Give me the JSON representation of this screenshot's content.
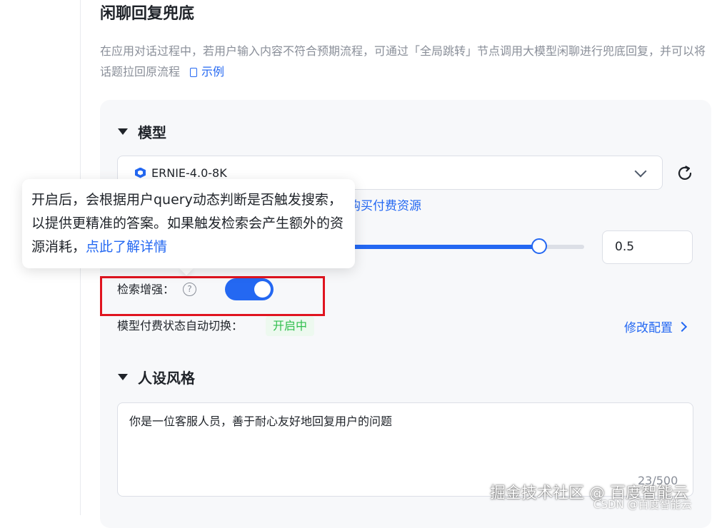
{
  "header": {
    "title": "闲聊回复兜底",
    "description": "在应用对话过程中，若用户输入内容不符合预期流程，可通过「全局跳转」节点调用大模型闲聊进行兜底回复，并可以将话题拉回原流程",
    "example_link": "示例"
  },
  "model_section": {
    "title": "模型",
    "selected_model": "ERNIE-4.0-8K",
    "buy_link_fragment": "购买付费资源",
    "temperature_value": "0.5",
    "temperature_level": 0.5,
    "search_enhance_label": "检索增强：",
    "search_enhance_enabled": true,
    "auto_switch_label": "模型付费状态自动切换：",
    "auto_switch_status": "开启中",
    "modify_config_link": "修改配置"
  },
  "tooltip": {
    "text": "开启后，会根据用户query动态判断是否触发搜索，以提供更精准的答案。如果触发检索会产生额外的资源消耗，",
    "link": "点此了解详情"
  },
  "persona_section": {
    "title": "人设风格",
    "value": "你是一位客服人员，善于耐心友好地回复用户的问题",
    "char_count": "23/500"
  },
  "watermark": {
    "main": "掘金技术社区 @ 百度智能云",
    "sub": "CSDN @百度智能云"
  },
  "colors": {
    "accent": "#2468f2",
    "highlight_border": "#e0141f",
    "status_green": "#30bf4d"
  }
}
